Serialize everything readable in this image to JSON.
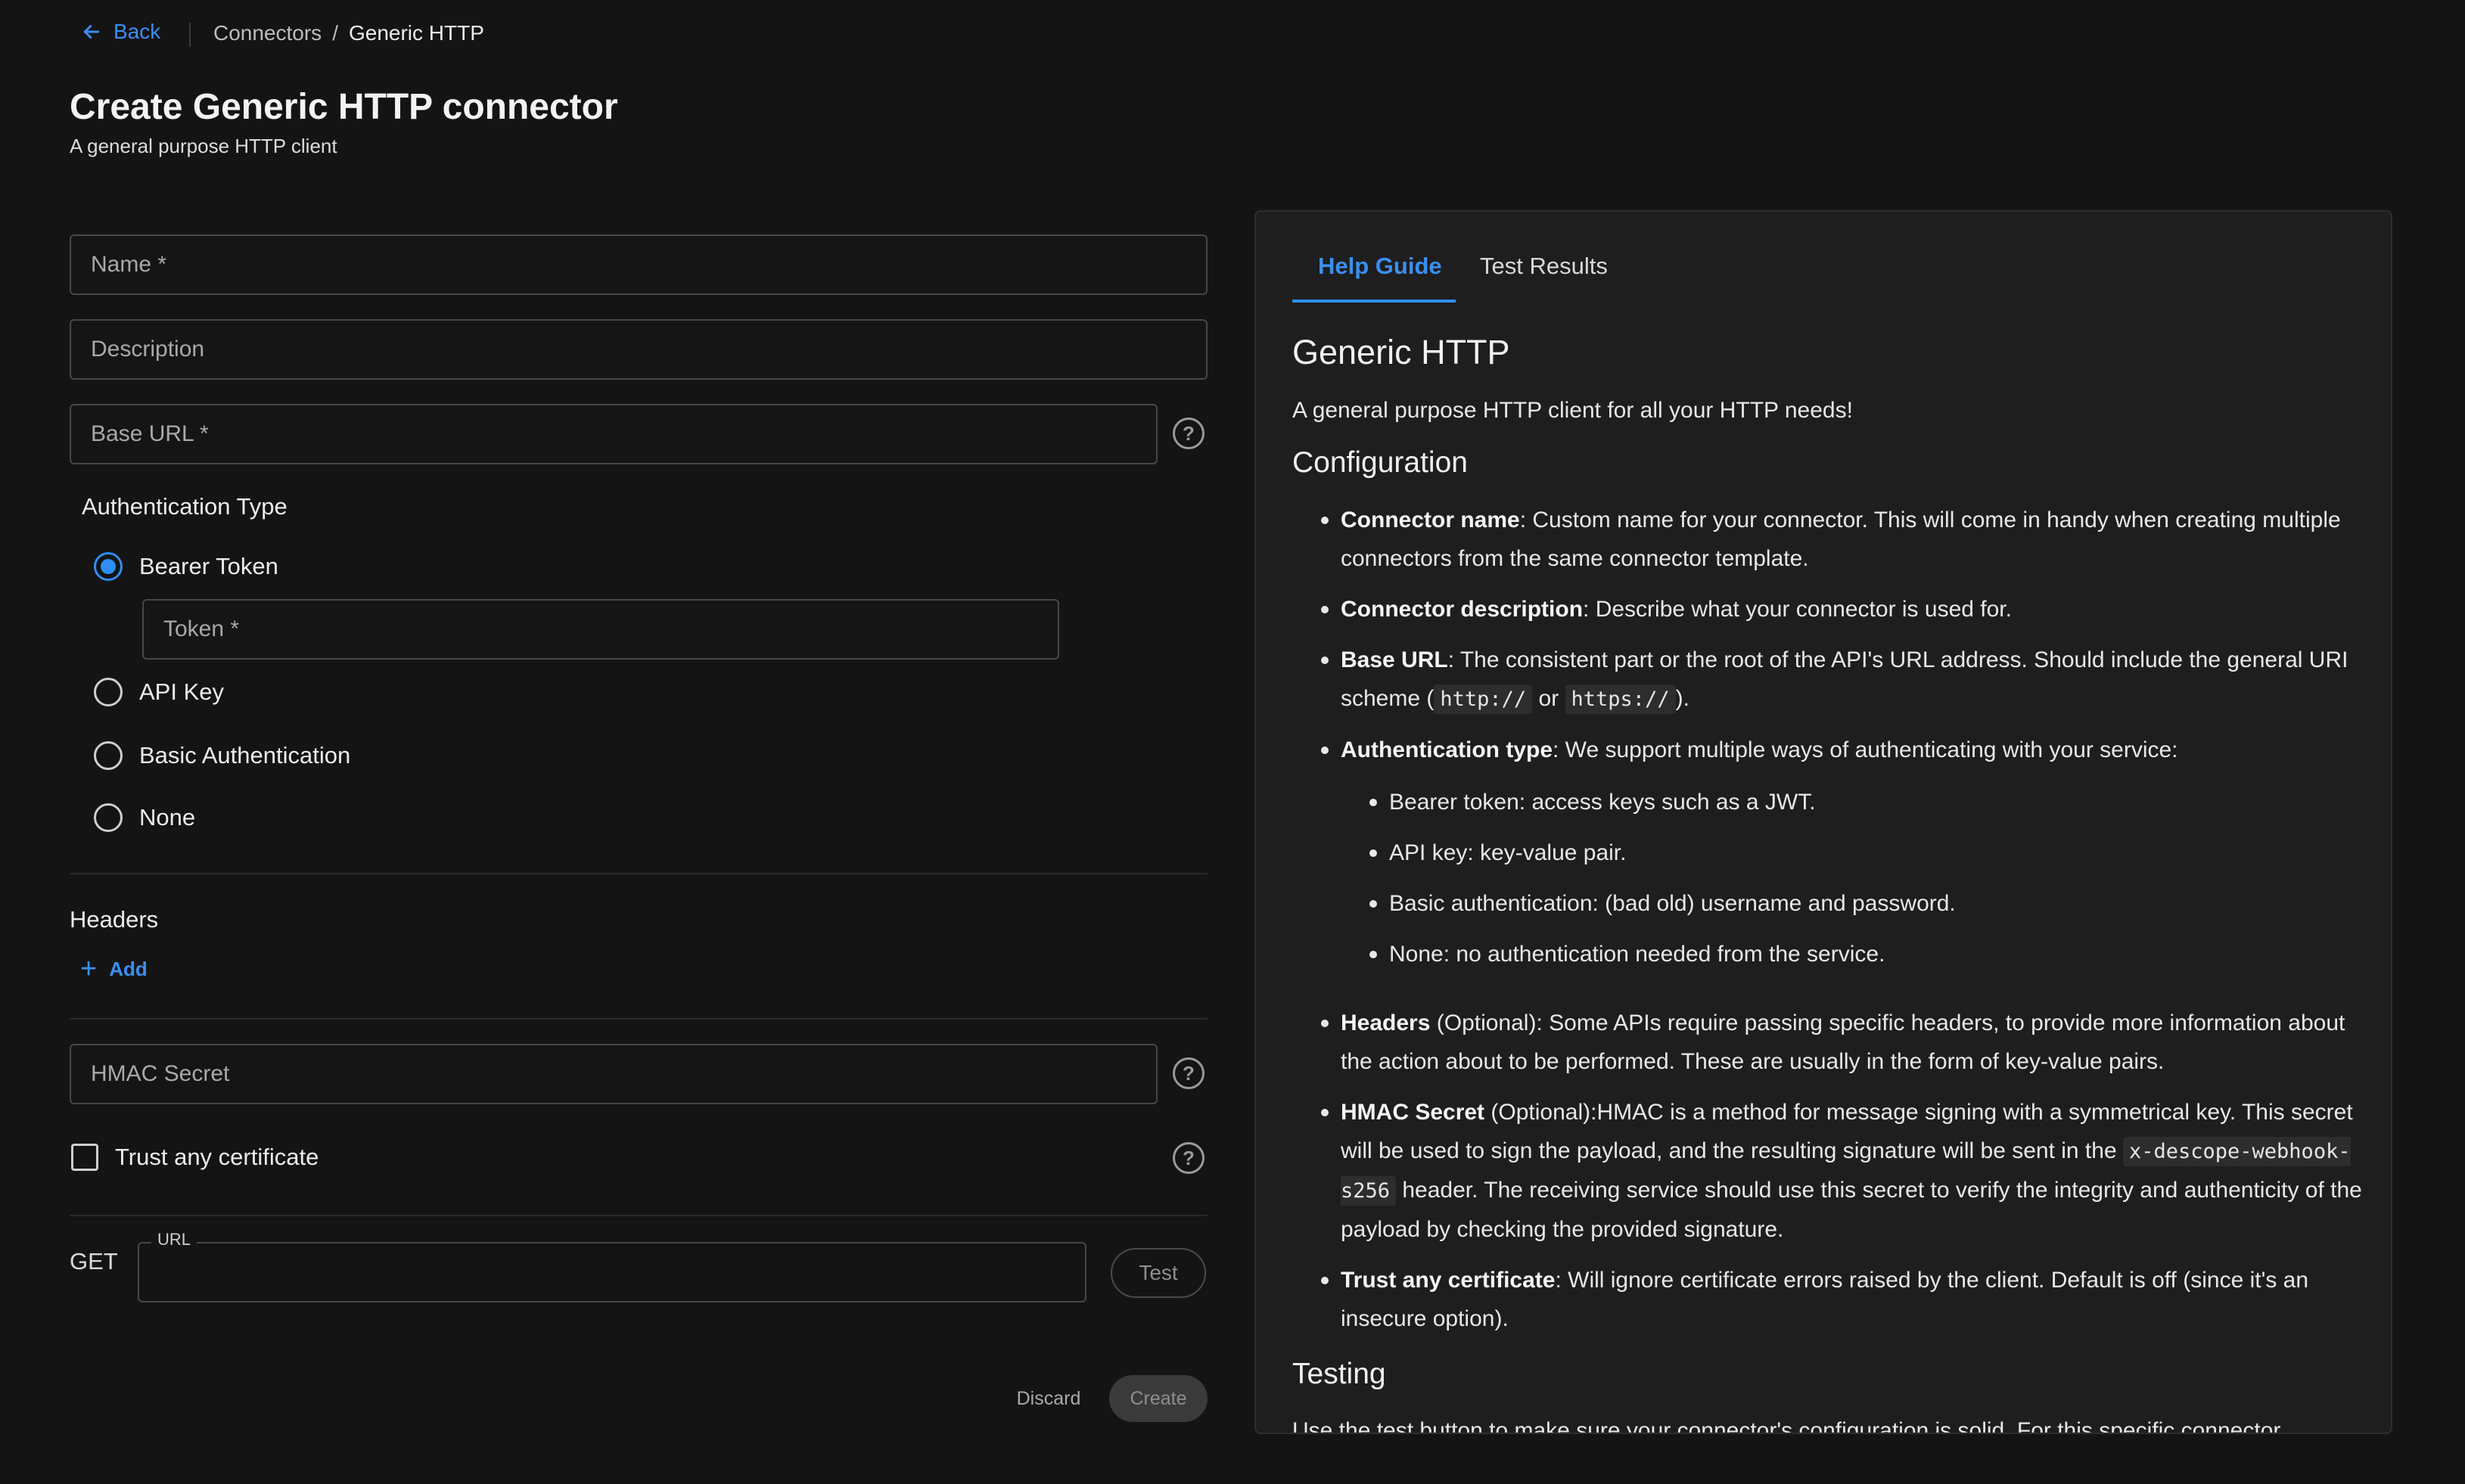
{
  "header": {
    "back_label": "Back",
    "breadcrumb_parent": "Connectors",
    "breadcrumb_sep": "/",
    "breadcrumb_current": "Generic HTTP",
    "title": "Create Generic HTTP connector",
    "subtitle": "A general purpose HTTP client"
  },
  "form": {
    "name_placeholder": "Name *",
    "description_placeholder": "Description",
    "base_url_placeholder": "Base URL *",
    "auth_type_label": "Authentication Type",
    "auth_options": [
      "Bearer Token",
      "API Key",
      "Basic Authentication",
      "None"
    ],
    "auth_selected": "Bearer Token",
    "token_placeholder": "Token *",
    "headers_label": "Headers",
    "add_label": "Add",
    "hmac_placeholder": "HMAC Secret",
    "trust_cert_label": "Trust any certificate",
    "method": "GET",
    "url_label": "URL",
    "url_value": "",
    "test_label": "Test",
    "discard_label": "Discard",
    "create_label": "Create"
  },
  "panel": {
    "tabs": [
      "Help Guide",
      "Test Results"
    ],
    "active_tab": "Help Guide",
    "heading": "Generic HTTP",
    "intro": "A general purpose HTTP client for all your HTTP needs!",
    "config_heading": "Configuration",
    "items": {
      "connector_name_term": "Connector name",
      "connector_name_text": ": Custom name for your connector. This will come in handy when creating multiple connectors from the same connector template.",
      "connector_desc_term": "Connector description",
      "connector_desc_text": ": Describe what your connector is used for.",
      "base_url_term": "Base URL",
      "base_url_text": ": The consistent part or the root of the API's URL address. Should include the general URI scheme (",
      "base_url_code1": "http://",
      "base_url_or": " or ",
      "base_url_code2": "https://",
      "base_url_end": ").",
      "auth_term": "Authentication type",
      "auth_text": ": We support multiple ways of authenticating with your service:",
      "auth_sub": [
        "Bearer token: access keys such as a JWT.",
        "API key: key-value pair.",
        "Basic authentication: (bad old) username and password.",
        "None: no authentication needed from the service."
      ],
      "headers_term": "Headers",
      "headers_text": " (Optional): Some APIs require passing specific headers, to provide more information about the action about to be performed. These are usually in the form of key-value pairs.",
      "hmac_term": "HMAC Secret",
      "hmac_text": " (Optional):HMAC is a method for message signing with a symmetrical key. This secret will be used to sign the payload, and the resulting signature will be sent in the ",
      "hmac_code": "x-descope-webhook-s256",
      "hmac_end": " header. The receiving service should use this secret to verify the integrity and authenticity of the payload by checking the provided signature.",
      "trust_term": "Trust any certificate",
      "trust_text": ": Will ignore certificate errors raised by the client. Default is off (since it's an insecure option)."
    },
    "testing_heading": "Testing",
    "testing_text": "Use the test button to make sure your connector's configuration is solid. For this specific connector"
  },
  "colors": {
    "accent": "#2f8ef5",
    "background": "#141414",
    "panel": "#1e1e1e"
  }
}
